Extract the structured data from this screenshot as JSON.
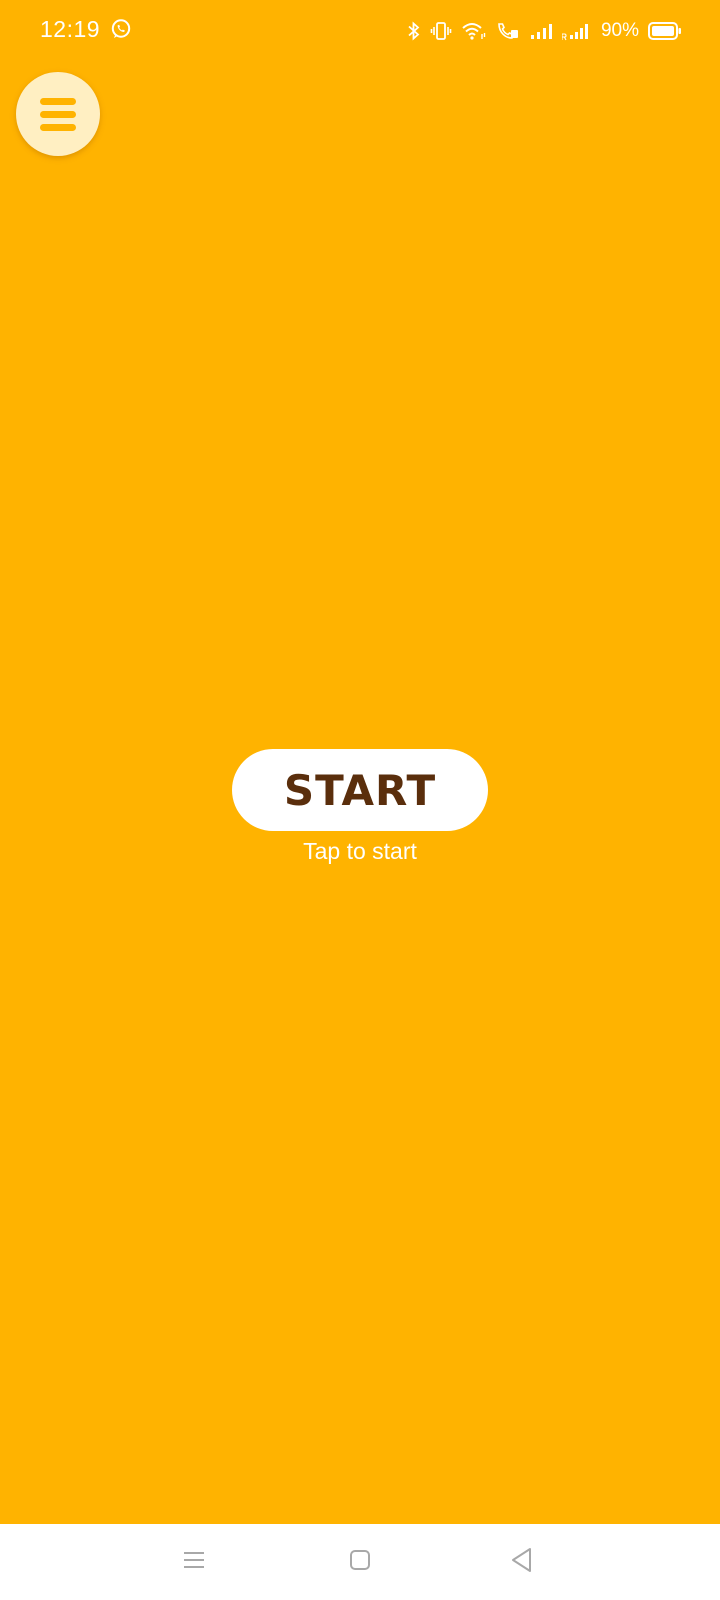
{
  "status_bar": {
    "time": "12:19",
    "left_icons": [
      "whatsapp-icon"
    ],
    "right_icons": [
      "bluetooth-icon",
      "vibrate-icon",
      "wifi-icon",
      "volte-call-icon",
      "signal-icon",
      "signal-roaming-icon",
      "battery-icon"
    ],
    "battery_percent": "90%"
  },
  "menu": {
    "icon": "hamburger-menu-icon"
  },
  "main": {
    "start_label": "START",
    "hint": "Tap to start"
  },
  "nav_bar": {
    "items": [
      "recents-icon",
      "home-icon",
      "back-icon"
    ]
  },
  "colors": {
    "background": "#FFB300",
    "menu_button": "#FFEFC2",
    "start_text": "#5A2E0C",
    "nav_bar": "#FFFFFF"
  }
}
